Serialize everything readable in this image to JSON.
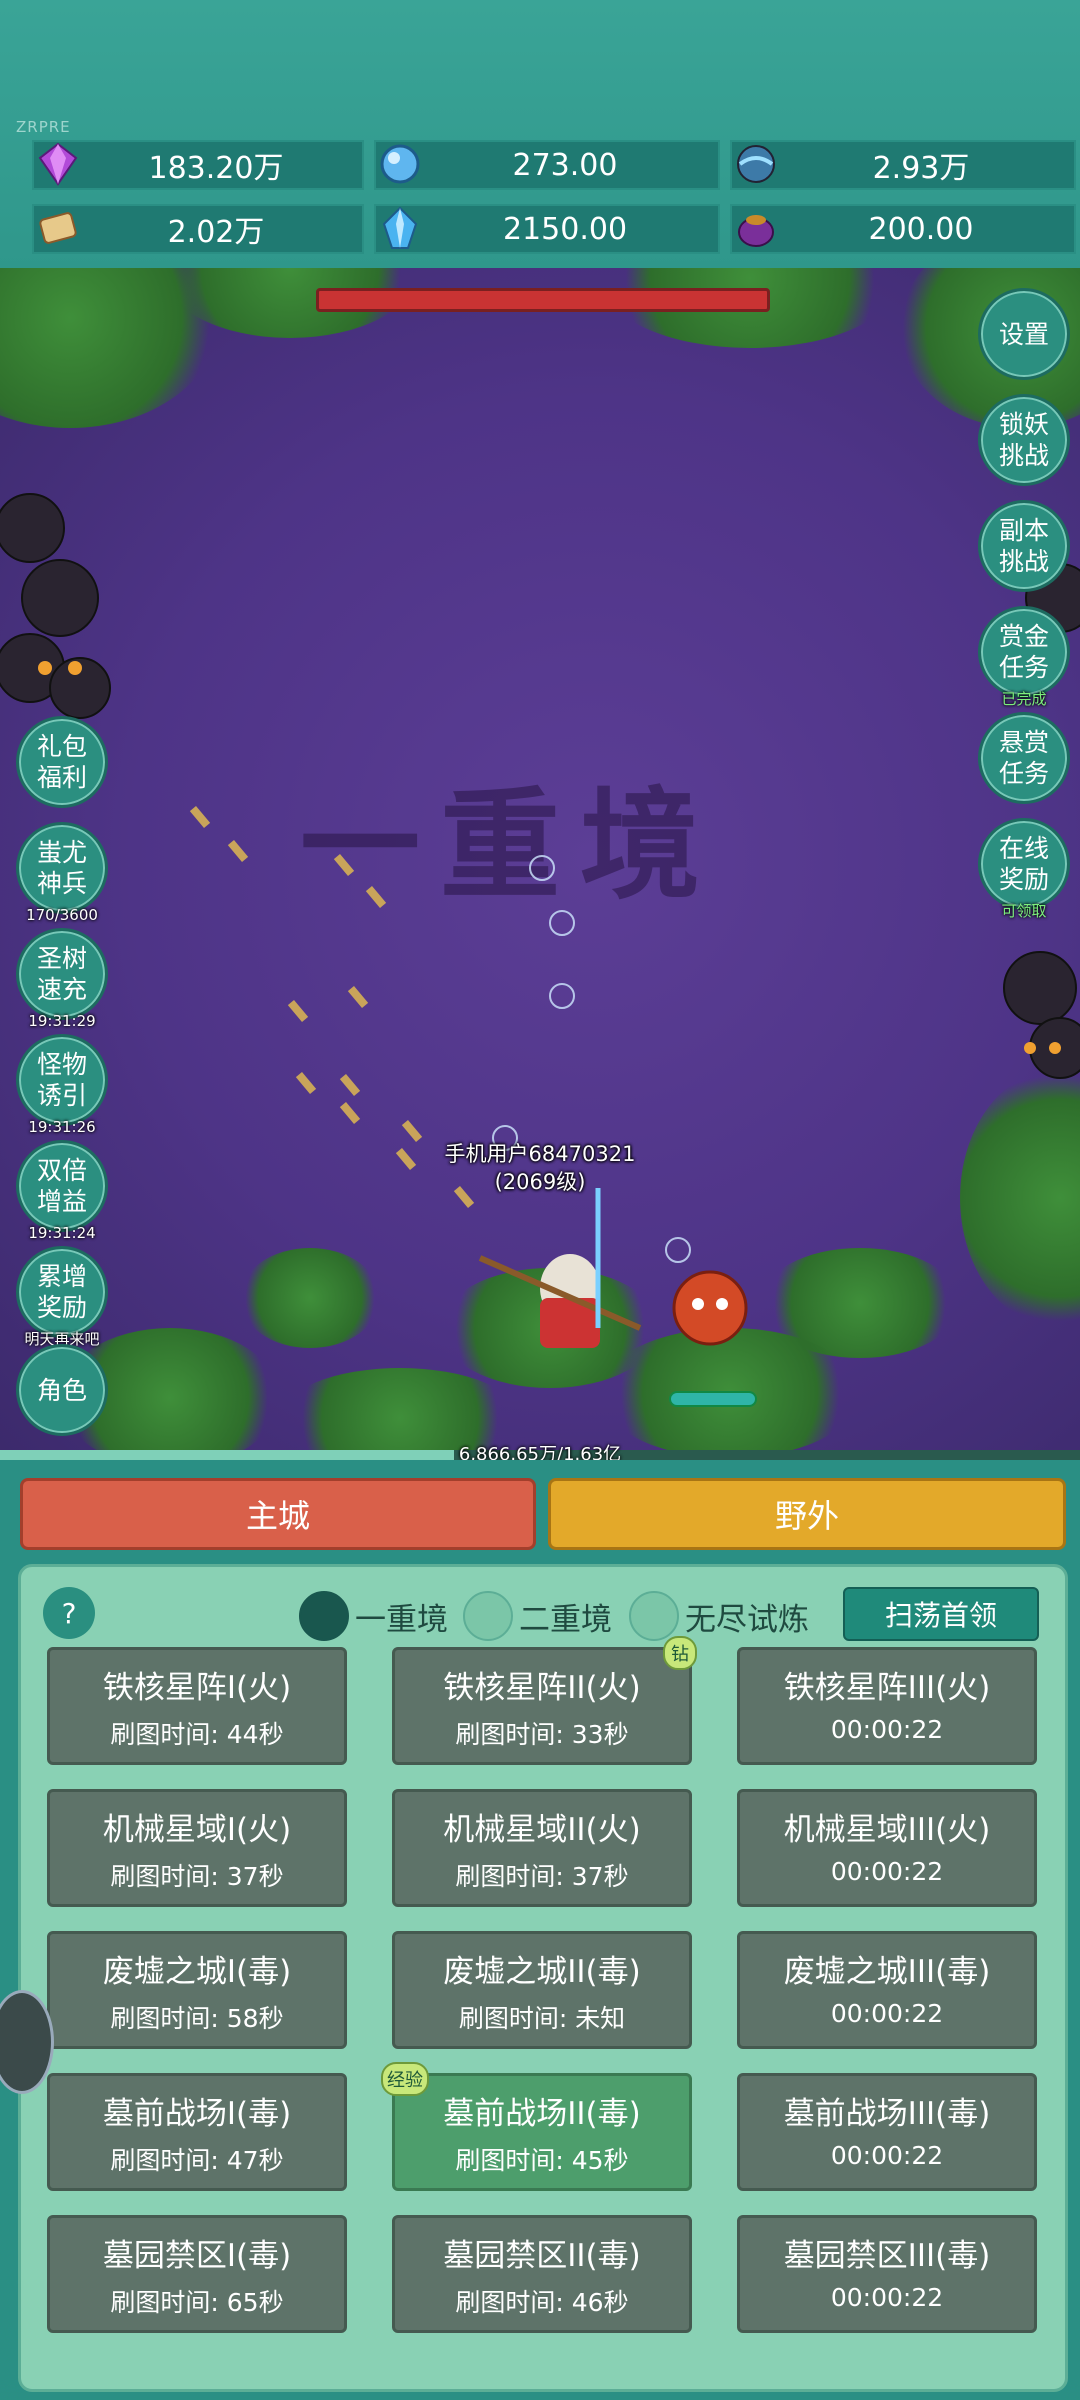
{
  "watermark": "ZRPRE",
  "resources": [
    {
      "icon": "purple-gem-icon",
      "value": "183.20万"
    },
    {
      "icon": "blue-orb-icon",
      "value": "273.00"
    },
    {
      "icon": "blue-sphere-icon",
      "value": "2.93万"
    },
    {
      "icon": "scroll-icon",
      "value": "2.02万"
    },
    {
      "icon": "blue-crystal-icon",
      "value": "2150.00"
    },
    {
      "icon": "purple-pot-icon",
      "value": "200.00"
    }
  ],
  "scene": {
    "realm_text": "一重境",
    "player_name": "手机用户68470321",
    "player_level": "(2069级)",
    "exp_text": "6,866.65万/1.63亿",
    "boss_hp_fraction": 1.0,
    "exp_fraction": 0.42
  },
  "right_buttons": [
    {
      "label": "设置",
      "sub": ""
    },
    {
      "label": "锁妖挑战",
      "sub": ""
    },
    {
      "label": "副本挑战",
      "sub": ""
    },
    {
      "label": "赏金任务",
      "sub": "已完成"
    },
    {
      "label": "悬赏任务",
      "sub": ""
    },
    {
      "label": "在线奖励",
      "sub": "可领取"
    }
  ],
  "left_buttons": [
    {
      "label": "礼包福利",
      "sub": ""
    },
    {
      "label": "蚩尤神兵",
      "sub": "170/3600"
    },
    {
      "label": "圣树速充",
      "sub": "19:31:29"
    },
    {
      "label": "怪物诱引",
      "sub": "19:31:26"
    },
    {
      "label": "双倍增益",
      "sub": "19:31:24"
    },
    {
      "label": "累增奖励",
      "sub": "明天再来吧"
    },
    {
      "label": "角色",
      "sub": ""
    }
  ],
  "tabs": {
    "main_city": "主城",
    "wild": "野外"
  },
  "panel": {
    "help": "?",
    "modes": [
      "一重境",
      "二重境",
      "无尽试炼"
    ],
    "selected_mode": "一重境",
    "sweep_button": "扫荡首领",
    "badge_diamond": "钻",
    "badge_exp": "经验",
    "stages": [
      {
        "name": "铁核星阵I(火)",
        "time": "刷图时间: 44秒"
      },
      {
        "name": "铁核星阵II(火)",
        "time": "刷图时间: 33秒"
      },
      {
        "name": "铁核星阵III(火)",
        "time": "00:00:22"
      },
      {
        "name": "机械星域I(火)",
        "time": "刷图时间: 37秒"
      },
      {
        "name": "机械星域II(火)",
        "time": "刷图时间: 37秒"
      },
      {
        "name": "机械星域III(火)",
        "time": "00:00:22"
      },
      {
        "name": "废墟之城I(毒)",
        "time": "刷图时间: 58秒"
      },
      {
        "name": "废墟之城II(毒)",
        "time": "刷图时间: 未知"
      },
      {
        "name": "废墟之城III(毒)",
        "time": "00:00:22"
      },
      {
        "name": "墓前战场I(毒)",
        "time": "刷图时间: 47秒"
      },
      {
        "name": "墓前战场II(毒)",
        "time": "刷图时间: 45秒"
      },
      {
        "name": "墓前战场III(毒)",
        "time": "00:00:22"
      },
      {
        "name": "墓园禁区I(毒)",
        "time": "刷图时间: 65秒"
      },
      {
        "name": "墓园禁区II(毒)",
        "time": "刷图时间: 46秒"
      },
      {
        "name": "墓园禁区III(毒)",
        "time": "00:00:22"
      }
    ]
  }
}
